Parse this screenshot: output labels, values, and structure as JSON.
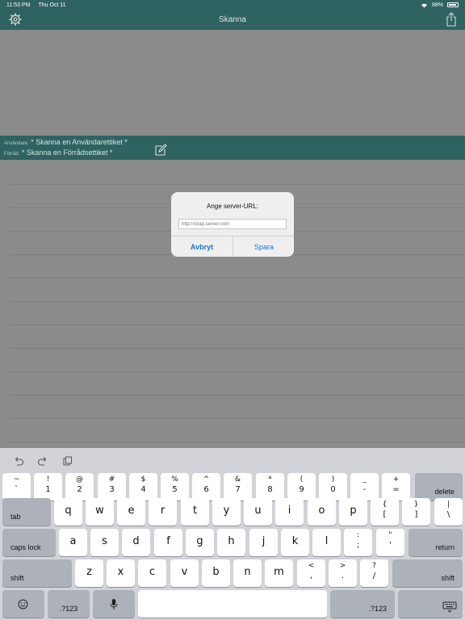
{
  "status_bar": {
    "time": "11:53 PM",
    "date": "Thu Oct 11",
    "battery": "88%"
  },
  "nav": {
    "title": "Skanna",
    "left_icon": "gear-icon",
    "right_icon": "share-icon"
  },
  "info": {
    "user_label": "Användare:",
    "user_value": "* Skanna en Användarettiket *",
    "store_label": "Förråd:",
    "store_value": "* Skanna en Förrådsettiket *"
  },
  "dialog": {
    "title": "Ange server-URL:",
    "input_value": "",
    "input_placeholder": "http://soap.server.com",
    "cancel_label": "Avbryt",
    "save_label": "Spara"
  },
  "keyboard": {
    "toolbar_icons": [
      "undo-icon",
      "redo-icon",
      "paste-icon"
    ],
    "number_row": [
      {
        "top": "~",
        "bot": "`"
      },
      {
        "top": "!",
        "bot": "1"
      },
      {
        "top": "@",
        "bot": "2"
      },
      {
        "top": "#",
        "bot": "3"
      },
      {
        "top": "$",
        "bot": "4"
      },
      {
        "top": "%",
        "bot": "5"
      },
      {
        "top": "^",
        "bot": "6"
      },
      {
        "top": "&",
        "bot": "7"
      },
      {
        "top": "*",
        "bot": "8"
      },
      {
        "top": "(",
        "bot": "9"
      },
      {
        "top": ")",
        "bot": "0"
      },
      {
        "top": "_",
        "bot": "-"
      },
      {
        "top": "+",
        "bot": "="
      }
    ],
    "delete_label": "delete",
    "tab_label": "tab",
    "q_row": [
      "q",
      "w",
      "e",
      "r",
      "t",
      "y",
      "u",
      "i",
      "o",
      "p"
    ],
    "q_row_extra": [
      {
        "top": "{",
        "bot": "["
      },
      {
        "top": "}",
        "bot": "]"
      },
      {
        "top": "|",
        "bot": "\\"
      }
    ],
    "caps_label": "caps lock",
    "a_row": [
      "a",
      "s",
      "d",
      "f",
      "g",
      "h",
      "j",
      "k",
      "l"
    ],
    "a_row_extra": [
      {
        "top": ":",
        "bot": ";"
      },
      {
        "top": "\"",
        "bot": "'"
      }
    ],
    "return_label": "return",
    "shift_label": "shift",
    "z_row": [
      "z",
      "x",
      "c",
      "v",
      "b",
      "n",
      "m"
    ],
    "z_row_extra": [
      {
        "top": "<",
        "bot": ","
      },
      {
        "top": ">",
        "bot": "."
      },
      {
        "top": "?",
        "bot": "/"
      }
    ],
    "numbers_label": ".?123"
  }
}
